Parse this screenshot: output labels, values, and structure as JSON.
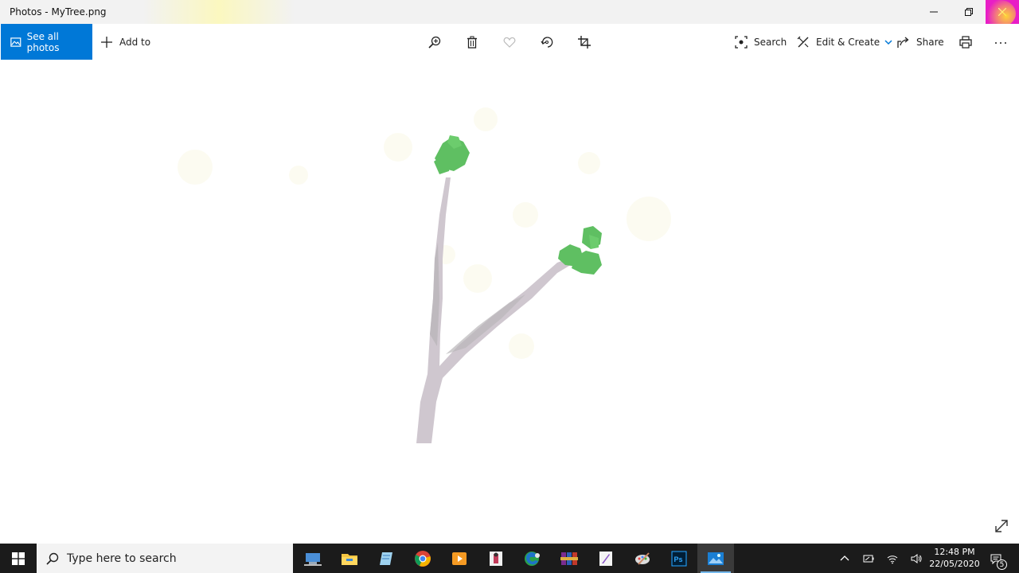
{
  "window": {
    "title": "Photos - MyTree.png",
    "close_highlight": "#e81ec6"
  },
  "toolbar": {
    "see_all_label": "See all photos",
    "add_to_label": "Add to",
    "search_label": "Search",
    "edit_create_label": "Edit & Create",
    "share_label": "Share",
    "accent": "#0078d7"
  },
  "image": {
    "trunk_color": "#c8c0c8",
    "leaf_color": "#5fbf62"
  },
  "taskbar": {
    "search_placeholder": "Type here to search",
    "time": "12:48 PM",
    "date": "22/05/2020",
    "notification_count": "5",
    "apps": [
      "network-app-icon",
      "file-explorer-icon",
      "notepad-icon",
      "chrome-icon",
      "media-player-icon",
      "document-icon",
      "edge-icon",
      "winrar-icon",
      "inkscape-icon",
      "paint-icon",
      "photoshop-icon",
      "photos-icon"
    ]
  }
}
